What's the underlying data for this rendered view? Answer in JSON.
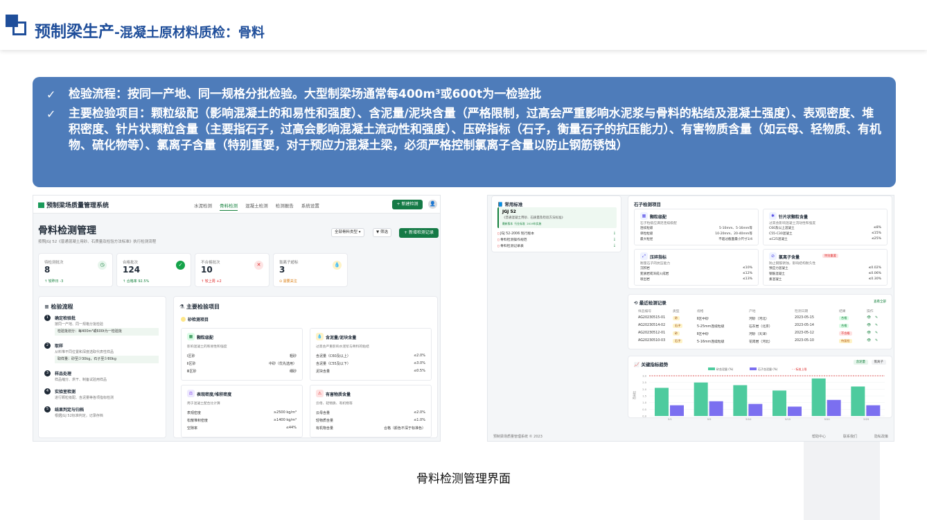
{
  "slide": {
    "title_main": "预制梁生产",
    "title_sub": "-混凝土原材料质检：骨料",
    "bullets": [
      "检验流程：按同一产地、同一规格分批检验。大型制梁场通常每400m³或600t为一检验批",
      "主要检验项目：颗粒级配（影响混凝土的和易性和强度）、含泥量/泥块含量（严格限制，过高会严重影响水泥浆与骨料的粘结及混凝土强度）、表观密度、堆积密度、针片状颗粒含量（主要指石子，过高会影响混凝土流动性和强度）、压碎指标（石子，衡量石子的抗压能力）、有害物质含量（如云母、轻物质、有机物、硫化物等）、氯离子含量（特别重要，对于预应力混凝土梁，必须严格控制氯离子含量以防止钢筋锈蚀）"
    ],
    "caption": "骨料检测管理界面",
    "colors": {
      "brand": "#1f4e9a",
      "box": "#4e7cba",
      "green": "#157a46"
    }
  },
  "app": {
    "brand": "预制梁场质量管理系统",
    "nav": [
      "水泥检测",
      "骨料检测",
      "混凝土检测",
      "检测报告",
      "系统设置"
    ],
    "nav_active": 1,
    "new_test": "+ 新建检测",
    "avatar": "👤",
    "page_title": "骨料检测管理",
    "page_sub": "按照JGJ 52《普通混凝土用砂、石质量及检验方法标准》执行检测流程",
    "filter_type": "全部骨料类型 ▾",
    "filter": "▼ 筛选",
    "new_record": "+ 新增检测记录",
    "stats": [
      {
        "label": "待检测批次",
        "value": "8",
        "note": "↑ 较昨日 -3",
        "icon": "◷",
        "note_color": "#15803d",
        "icon_bg": "#e7f5ec",
        "icon_color": "#15803d"
      },
      {
        "label": "合格批次",
        "value": "124",
        "note": "↑ 合格率 92.5%",
        "icon": "✓",
        "note_color": "#15803d",
        "icon_bg": "#15a34a",
        "icon_color": "#ffffff"
      },
      {
        "label": "不合格批次",
        "value": "10",
        "note": "↑ 较上周 +2",
        "icon": "✕",
        "note_color": "#dc2626",
        "icon_bg": "#fde4e4",
        "icon_color": "#dc2626"
      },
      {
        "label": "氯离子超标",
        "value": "3",
        "note": "⊙ 需要关注",
        "icon": "💧",
        "note_color": "#d97706",
        "icon_bg": "#fef3c7",
        "icon_color": "#d97706"
      }
    ],
    "flow": {
      "title": "≡ 检验流程",
      "steps": [
        {
          "n": "1",
          "title": "确定检验批",
          "desc": "按同一产地、同一规格分批检验",
          "box": "检验批划分：每400m³或600t为一检验批"
        },
        {
          "n": "2",
          "title": "取样",
          "desc": "从料堆不同位置和深度选取代表性样品",
          "box": "取样量：砂至少30kg，石子至少80kg"
        },
        {
          "n": "3",
          "title": "样品处理",
          "desc": "样品缩分、烘干、制备试验用样品",
          "box": ""
        },
        {
          "n": "4",
          "title": "实验室检测",
          "desc": "进行颗粒级配、含泥量等各项指标检测",
          "box": ""
        },
        {
          "n": "5",
          "title": "结果判定与归档",
          "desc": "根据JGJ 52标准判定，记录存档",
          "box": ""
        }
      ]
    },
    "items": {
      "title": "⚗ 主要检验项目",
      "sand_tag": "砂检测项目",
      "cards": [
        {
          "icon": "▦",
          "icon_bg": "#dcfce7",
          "icon_color": "#15803d",
          "title": "颗粒级配",
          "desc": "影响混凝土的和易性和强度",
          "rows": [
            [
              "Ⅰ区砂",
              "粗砂"
            ],
            [
              "Ⅱ区砂",
              "中砂（优先选用）"
            ],
            [
              "Ⅲ区砂",
              "细砂"
            ]
          ]
        },
        {
          "icon": "💧",
          "icon_bg": "#fef3c7",
          "icon_color": "#d97706",
          "title": "含泥量/泥块含量",
          "desc": "过高会严重影响水泥浆与骨料的粘结",
          "rows": [
            [
              "含泥量（C60及以上）",
              "≤2.0%"
            ],
            [
              "含泥量（C55及以下）",
              "≤3.0%"
            ],
            [
              "泥块含量",
              "≤0.5%"
            ]
          ]
        },
        {
          "icon": "⚖",
          "icon_bg": "#ede9fe",
          "icon_color": "#7c3aed",
          "title": "表观密度/堆积密度",
          "desc": "用于混凝土配合比计算",
          "rows": [
            [
              "表观密度",
              "≥2500 kg/m³"
            ],
            [
              "松散堆积密度",
              "≥1400 kg/m³"
            ],
            [
              "空隙率",
              "≤44%"
            ]
          ]
        },
        {
          "icon": "⚠",
          "icon_bg": "#fee2e2",
          "icon_color": "#dc2626",
          "title": "有害物质含量",
          "desc": "云母、轻物质、有机物等",
          "rows": [
            [
              "云母含量",
              "≤2.0%"
            ],
            [
              "轻物质含量",
              "≤1.0%"
            ],
            [
              "有机物含量",
              "合格（颜色不深于标准色）"
            ]
          ]
        }
      ]
    }
  },
  "app2": {
    "std_title": "常用标准",
    "std_main": "JGJ 52",
    "std_main_desc": "《普通混凝土用砂、石质量及检验方法标准》",
    "std_tags": [
      "最新版本",
      "行业标准",
      "2019年实施"
    ],
    "std_links": [
      "JGJ 52-2006 现行版本",
      "骨料检测操作规范",
      "骨料检测记录表"
    ],
    "stone_title": "石子检测项目",
    "stone_cards": [
      {
        "icon": "▦",
        "title": "颗粒级配",
        "desc": "石子粒级应满足连续级配",
        "rows": [
          [
            "连续粒级",
            "5-10mm、5-16mm等"
          ],
          [
            "单粒粒级",
            "10-20mm、20-40mm等"
          ],
          [
            "最大粒径",
            "不超过截面最小尺寸1/4"
          ]
        ]
      },
      {
        "icon": "✱",
        "title": "针片状颗粒含量",
        "desc": "过高会影响混凝土流动性和强度",
        "rows": [
          [
            "C60及以上混凝土",
            "≤8%"
          ],
          [
            "C55-C30混凝土",
            "≤15%"
          ],
          [
            "≤C25混凝土",
            "≤25%"
          ]
        ]
      },
      {
        "icon": "⤢",
        "title": "压碎指标",
        "desc": "衡量石子的抗压能力",
        "rows": [
          [
            "沉积岩",
            "≤10%"
          ],
          [
            "变质岩或深成火成岩",
            "≤12%"
          ],
          [
            "喷出岩",
            "≤13%"
          ]
        ]
      },
      {
        "icon": "⊘",
        "title": "氯离子含量",
        "badge": "特别重要",
        "desc": "防止钢筋锈蚀，影响结构耐久性",
        "rows": [
          [
            "预应力混凝土",
            "≤0.02%"
          ],
          [
            "钢筋混凝土",
            "≤0.06%"
          ],
          [
            "素混凝土",
            "≤0.30%"
          ]
        ]
      }
    ],
    "recent_title": "最近检测记录",
    "recent_all": "查看全部",
    "recent_headers": [
      "样品编号",
      "类型",
      "规格",
      "产地",
      "检测日期",
      "结果",
      "操作"
    ],
    "recent_rows": [
      [
        "AG20230515-01",
        "砂",
        "Ⅱ区中砂",
        "河砂（河北）",
        "2023-05-15",
        "合格"
      ],
      [
        "AG20230514-02",
        "石子",
        "5-25mm连续粒级",
        "石灰岩（北京）",
        "2023-05-14",
        "合格"
      ],
      [
        "AG20230512-01",
        "砂",
        "Ⅱ区中砂",
        "河砂（天津）",
        "2023-05-12",
        "不合格"
      ],
      [
        "AG20230510-03",
        "石子",
        "5-16mm连续粒级",
        "花岗岩（河北）",
        "2023-05-10",
        "待复检"
      ]
    ],
    "trend_title": "关键指标趋势",
    "trend_tabs": [
      "含泥量",
      "氯离子"
    ],
    "footer_left": "预制梁场质量管理系统 © 2023",
    "footer_links": [
      "帮助中心",
      "联系我们",
      "隐私政策"
    ]
  },
  "chart_data": {
    "type": "bar",
    "categories": [
      "5/1",
      "5/5",
      "5/10",
      "5/15",
      "5/20",
      "5/25"
    ],
    "series": [
      {
        "name": "砂含泥量 (%)",
        "values": [
          2.1,
          2.5,
          2.3,
          1.9,
          2.8,
          2.2
        ],
        "color": "#4ecb9e"
      },
      {
        "name": "石子含泥量 (%)",
        "values": [
          0.8,
          1.1,
          0.9,
          0.7,
          1.2,
          0.8
        ],
        "color": "#7b6ff0"
      }
    ],
    "ylabel": "百分比",
    "ylim": [
      0,
      3
    ],
    "threshold": {
      "name": "标准上限",
      "value": 3.0
    }
  }
}
